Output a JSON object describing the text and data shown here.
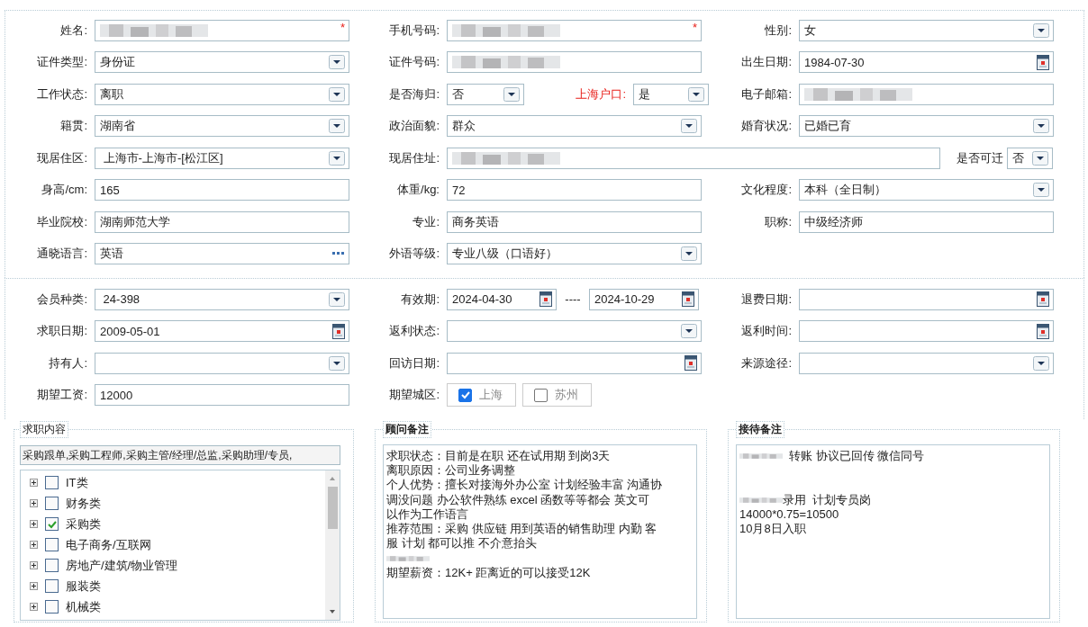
{
  "sections": [
    {
      "rows": [
        {
          "cells": [
            {
              "kind": "text",
              "label": "姓名:",
              "redacted": true,
              "required": true,
              "required_mark": "*"
            },
            {
              "kind": "text",
              "label": "手机号码:",
              "redacted": true,
              "required": true,
              "required_mark": "*"
            },
            {
              "kind": "select",
              "label": "性别:",
              "value": "女"
            }
          ]
        },
        {
          "cells": [
            {
              "kind": "select",
              "label": "证件类型:",
              "value": "身份证"
            },
            {
              "kind": "text",
              "label": "证件号码:",
              "redacted": true
            },
            {
              "kind": "date",
              "label": "出生日期:",
              "value": "1984-07-30"
            }
          ]
        },
        {
          "cells": [
            {
              "kind": "select",
              "label": "工作状态:",
              "value": "离职"
            },
            {
              "kind": "split",
              "parts": [
                {
                  "label": "是否海归:",
                  "value": "否",
                  "emphasis": false
                },
                {
                  "label": "上海户口:",
                  "value": "是",
                  "emphasis": true
                }
              ]
            },
            {
              "kind": "text",
              "label": "电子邮箱:",
              "redacted": true
            }
          ]
        },
        {
          "cells": [
            {
              "kind": "select",
              "label": "籍贯:",
              "value": "湖南省"
            },
            {
              "kind": "select",
              "label": "政治面貌:",
              "value": "群众"
            },
            {
              "kind": "select",
              "label": "婚育状况:",
              "value": "已婚已育"
            }
          ]
        },
        {
          "cells": [
            {
              "kind": "select",
              "label": "现居住区:",
              "value": " 上海市-上海市-[松江区]"
            },
            {
              "kind": "wide",
              "label": "现居住址:",
              "redacted": true,
              "suffix": {
                "label": "是否可迁",
                "value": "否"
              }
            }
          ]
        },
        {
          "cells": [
            {
              "kind": "text",
              "label": "身高/cm:",
              "value": "165"
            },
            {
              "kind": "text",
              "label": "体重/kg:",
              "value": "72"
            },
            {
              "kind": "select",
              "label": "文化程度:",
              "value": "本科（全日制）"
            }
          ]
        },
        {
          "cells": [
            {
              "kind": "text",
              "label": "毕业院校:",
              "value": "湖南师范大学"
            },
            {
              "kind": "text",
              "label": "专业:",
              "value": "商务英语"
            },
            {
              "kind": "text",
              "label": "职称:",
              "value": "中级经济师"
            }
          ]
        },
        {
          "cells": [
            {
              "kind": "lookup",
              "label": "通晓语言:",
              "value": "英语"
            },
            {
              "kind": "select",
              "label": "外语等级:",
              "value": "专业八级（口语好）"
            }
          ]
        }
      ]
    },
    {
      "rows": [
        {
          "cells": [
            {
              "kind": "select",
              "label": "会员种类:",
              "value": " 24-398"
            },
            {
              "kind": "range",
              "label": "有效期:",
              "from": "2024-04-30",
              "separator": "----",
              "to": "2024-10-29"
            },
            {
              "kind": "date",
              "label": "退费日期:"
            }
          ]
        },
        {
          "cells": [
            {
              "kind": "date",
              "label": "求职日期:",
              "value": "2009-05-01"
            },
            {
              "kind": "select",
              "label": "返利状态:"
            },
            {
              "kind": "date",
              "label": "返利时间:"
            }
          ]
        },
        {
          "cells": [
            {
              "kind": "select",
              "label": "持有人:"
            },
            {
              "kind": "date",
              "label": "回访日期:"
            },
            {
              "kind": "select",
              "label": "来源途径:"
            }
          ]
        },
        {
          "cells": [
            {
              "kind": "text",
              "label": "期望工资:",
              "value": "12000"
            },
            {
              "kind": "checks",
              "label": "期望城区:",
              "options": [
                {
                  "label": "上海",
                  "checked": true
                },
                {
                  "label": "苏州",
                  "checked": false
                }
              ]
            }
          ]
        }
      ]
    }
  ],
  "job_panel": {
    "title": "求职内容",
    "value": "采购跟单,采购工程师,采购主管/经理/总监,采购助理/专员,",
    "tree": [
      {
        "label": "IT类",
        "checked": false
      },
      {
        "label": "财务类",
        "checked": false
      },
      {
        "label": "采购类",
        "checked": true
      },
      {
        "label": "电子商务/互联网",
        "checked": false
      },
      {
        "label": "房地产/建筑/物业管理",
        "checked": false
      },
      {
        "label": "服装类",
        "checked": false
      },
      {
        "label": "机械类",
        "checked": false
      }
    ]
  },
  "notes": [
    {
      "title": "顾问备注",
      "lines": [
        {
          "kind": "text",
          "text": "求职状态：目前是在职 还在试用期 到岗3天",
          "redacted": false
        },
        {
          "kind": "text",
          "text": "离职原因：公司业务调整",
          "redacted": false
        },
        {
          "kind": "text",
          "text": "个人优势：擅长对接海外办公室 计划经验丰富 沟通协",
          "redacted": false
        },
        {
          "kind": "text",
          "text": "调没问题 办公软件熟练 excel 函数等等都会 英文可",
          "redacted": false
        },
        {
          "kind": "text",
          "text": "以作为工作语言",
          "redacted": false
        },
        {
          "kind": "text",
          "text": "推荐范围：采购 供应链 用到英语的销售助理 内勤 客",
          "redacted": false
        },
        {
          "kind": "text",
          "text": "服 计划 都可以推 不介意抬头",
          "redacted": false
        },
        {
          "kind": "redacted"
        },
        {
          "kind": "text",
          "text": "期望薪资：12K+ 距离近的可以接受12K",
          "redacted": false
        }
      ]
    },
    {
      "title": "接待备注",
      "lines": [
        {
          "kind": "text",
          "text": "  转账 协议已回传 微信同号",
          "redacted": true
        },
        {
          "kind": "blank"
        },
        {
          "kind": "blank"
        },
        {
          "kind": "text",
          "text": "录用  计划专员岗",
          "redacted": true
        },
        {
          "kind": "text",
          "text": "14000*0.75=10500",
          "redacted": false
        },
        {
          "kind": "text",
          "text": "10月8日入职",
          "redacted": false
        }
      ]
    }
  ]
}
